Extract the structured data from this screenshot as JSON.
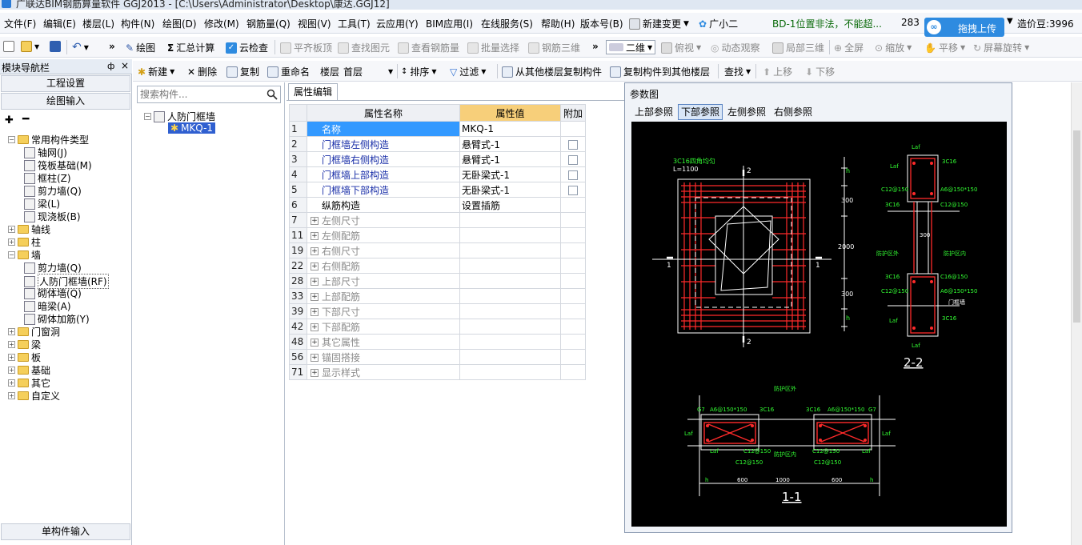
{
  "window": {
    "title": "广联达BIM钢筋算量软件 GGJ2013 - [C:\\Users\\Administrator\\Desktop\\康达.GGJ12]"
  },
  "menu": [
    "文件(F)",
    "编辑(E)",
    "楼层(L)",
    "构件(N)",
    "绘图(D)",
    "修改(M)",
    "钢筋量(Q)",
    "视图(V)",
    "工具(T)",
    "云应用(Y)",
    "BIM应用(I)",
    "在线服务(S)",
    "帮助(H)",
    "版本号(B)"
  ],
  "menu_extra": {
    "new_change": "新建变更",
    "assistant": "广小二",
    "notice": "BD-1位置非法，不能超...",
    "number": "283",
    "upload": "拖拽上传",
    "coins": "造价豆:3996"
  },
  "toolbar1": {
    "draw": "绘图",
    "sum": "汇总计算",
    "cloud_check": "云检查",
    "flush_slab": "平齐板顶",
    "find_elem": "查找图元",
    "view_rebar": "查看钢筋量",
    "batch_select": "批量选择",
    "rebar_3d": "钢筋三维",
    "mode_2d": "二维",
    "view_top": "俯视",
    "orbit": "动态观察",
    "local_3d": "局部三维",
    "fullscreen": "全屏",
    "zoom": "缩放",
    "pan": "平移",
    "rotate": "屏幕旋转"
  },
  "toolbar2": {
    "new": "新建",
    "delete": "删除",
    "copy": "复制",
    "rename": "重命名",
    "floor_label": "楼层",
    "floor_value": "首层",
    "sort": "排序",
    "filter": "过滤",
    "copy_from": "从其他楼层复制构件",
    "copy_to": "复制构件到其他楼层",
    "find": "查找",
    "move_up": "上移",
    "move_down": "下移"
  },
  "nav": {
    "title": "模块导航栏",
    "pin": "ф",
    "close": "×",
    "project_settings": "工程设置",
    "drawing_input": "绘图输入",
    "single_input": "单构件输入",
    "tree": [
      {
        "label": "常用构件类型",
        "level": 0,
        "expanded": true,
        "folder": true
      },
      {
        "label": "轴网(J)",
        "level": 1
      },
      {
        "label": "筏板基础(M)",
        "level": 1
      },
      {
        "label": "框柱(Z)",
        "level": 1
      },
      {
        "label": "剪力墙(Q)",
        "level": 1
      },
      {
        "label": "梁(L)",
        "level": 1
      },
      {
        "label": "现浇板(B)",
        "level": 1
      },
      {
        "label": "轴线",
        "level": 0,
        "folder": true
      },
      {
        "label": "柱",
        "level": 0,
        "folder": true
      },
      {
        "label": "墙",
        "level": 0,
        "expanded": true,
        "folder": true
      },
      {
        "label": "剪力墙(Q)",
        "level": 1
      },
      {
        "label": "人防门框墙(RF)",
        "level": 1,
        "selected": true
      },
      {
        "label": "砌体墙(Q)",
        "level": 1
      },
      {
        "label": "暗梁(A)",
        "level": 1
      },
      {
        "label": "砌体加筋(Y)",
        "level": 1
      },
      {
        "label": "门窗洞",
        "level": 0,
        "folder": true
      },
      {
        "label": "梁",
        "level": 0,
        "folder": true
      },
      {
        "label": "板",
        "level": 0,
        "folder": true
      },
      {
        "label": "基础",
        "level": 0,
        "folder": true
      },
      {
        "label": "其它",
        "level": 0,
        "folder": true
      },
      {
        "label": "自定义",
        "level": 0,
        "folder": true
      }
    ]
  },
  "components": {
    "search_placeholder": "搜索构件...",
    "group": "人防门框墙",
    "item": "MKQ-1"
  },
  "props": {
    "tab": "属性编辑",
    "col_name": "属性名称",
    "col_value": "属性值",
    "col_add": "附加",
    "rows": [
      {
        "n": "1",
        "name": "名称",
        "value": "MKQ-1",
        "cb": false,
        "exp": false,
        "style": "blue"
      },
      {
        "n": "2",
        "name": "门框墙左侧构造",
        "value": "悬臂式-1",
        "cb": true,
        "exp": false,
        "style": "blue"
      },
      {
        "n": "3",
        "name": "门框墙右侧构造",
        "value": "悬臂式-1",
        "cb": true,
        "exp": false,
        "style": "blue"
      },
      {
        "n": "4",
        "name": "门框墙上部构造",
        "value": "无卧梁式-1",
        "cb": true,
        "exp": false,
        "style": "blue"
      },
      {
        "n": "5",
        "name": "门框墙下部构造",
        "value": "无卧梁式-1",
        "cb": true,
        "exp": false,
        "style": "blue"
      },
      {
        "n": "6",
        "name": "纵筋构造",
        "value": "设置插筋",
        "cb": false,
        "exp": false,
        "style": "black"
      },
      {
        "n": "7",
        "name": "左侧尺寸",
        "value": "",
        "cb": false,
        "exp": true,
        "style": "gray"
      },
      {
        "n": "11",
        "name": "左侧配筋",
        "value": "",
        "cb": false,
        "exp": true,
        "style": "gray"
      },
      {
        "n": "19",
        "name": "右侧尺寸",
        "value": "",
        "cb": false,
        "exp": true,
        "style": "gray"
      },
      {
        "n": "22",
        "name": "右侧配筋",
        "value": "",
        "cb": false,
        "exp": true,
        "style": "gray"
      },
      {
        "n": "28",
        "name": "上部尺寸",
        "value": "",
        "cb": false,
        "exp": true,
        "style": "gray"
      },
      {
        "n": "33",
        "name": "上部配筋",
        "value": "",
        "cb": false,
        "exp": true,
        "style": "gray"
      },
      {
        "n": "39",
        "name": "下部尺寸",
        "value": "",
        "cb": false,
        "exp": true,
        "style": "gray"
      },
      {
        "n": "42",
        "name": "下部配筋",
        "value": "",
        "cb": false,
        "exp": true,
        "style": "gray"
      },
      {
        "n": "48",
        "name": "其它属性",
        "value": "",
        "cb": false,
        "exp": true,
        "style": "gray"
      },
      {
        "n": "56",
        "name": "锚固搭接",
        "value": "",
        "cb": false,
        "exp": true,
        "style": "gray"
      },
      {
        "n": "71",
        "name": "显示样式",
        "value": "",
        "cb": false,
        "exp": true,
        "style": "gray"
      }
    ]
  },
  "param": {
    "title": "参数图",
    "tabs": [
      "上部参照",
      "下部参照",
      "左侧参照",
      "右侧参照"
    ],
    "active_tab": 1,
    "labels": {
      "top_note": "3C16四角均匀",
      "top_len": "L=1100",
      "sec2": "2",
      "sec1": "1",
      "dim300": "300",
      "dim2000": "2000",
      "dim_h": "h",
      "laf": "Laf",
      "c16_3": "3C16",
      "c12": "C12@150",
      "a6": "A6@150*150",
      "c16": "C16@150",
      "prot_out": "防护区外",
      "prot_in": "防护区内",
      "sec22": "2-2",
      "sec11": "1-1",
      "d600": "600",
      "d1000": "1000",
      "door": "门框墙",
      "g7": "G7"
    }
  },
  "colors": {
    "accent": "#2e8be0",
    "selected_row": "#3399ff",
    "value_header": "#f7cf7a",
    "cad_red": "#ff2a2a",
    "cad_white": "#ffffff",
    "cad_green": "#33ff33"
  }
}
